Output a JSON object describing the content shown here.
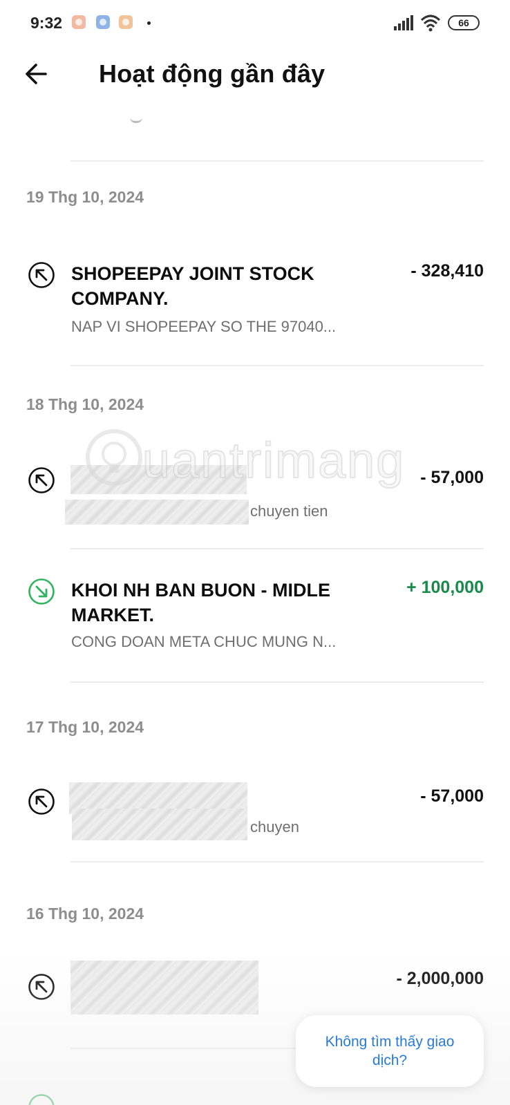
{
  "status_bar": {
    "time": "9:32",
    "battery": "66",
    "icons": [
      "notification-app-icon",
      "notification-app-icon",
      "notification-app-icon",
      "signal-icon",
      "wifi-icon",
      "battery-icon"
    ]
  },
  "header": {
    "title": "Hoạt động gần đây",
    "back_icon": "arrow-left-icon"
  },
  "watermark": {
    "text": "uantrimang"
  },
  "groups": [
    {
      "date": "19 Thg 10, 2024",
      "transactions": [
        {
          "direction": "out",
          "name": "SHOPEEPAY JOINT STOCK COMPANY.",
          "description": "NAP VI SHOPEEPAY SO THE 97040...",
          "amount": "- 328,410"
        }
      ]
    },
    {
      "date": "18 Thg 10, 2024",
      "transactions": [
        {
          "direction": "out",
          "name": "",
          "description": "chuyen tien",
          "amount": "- 57,000"
        },
        {
          "direction": "in",
          "name": "KHOI NH BAN BUON - MIDLE MARKET.",
          "description": "CONG DOAN META CHUC MUNG N...",
          "amount": "+ 100,000"
        }
      ]
    },
    {
      "date": "17 Thg 10, 2024",
      "transactions": [
        {
          "direction": "out",
          "name": "",
          "description": "chuyen",
          "amount": "- 57,000"
        }
      ]
    },
    {
      "date": "16 Thg 10, 2024",
      "transactions": [
        {
          "direction": "out",
          "name": "",
          "description": "",
          "amount": "- 2,000,000"
        }
      ]
    }
  ],
  "help_button": {
    "label": "Không tìm thấy giao dịch?"
  },
  "colors": {
    "positive": "#1a8a4b",
    "negative": "#111111",
    "link": "#2a7bd6",
    "date": "#8d8d8d"
  }
}
